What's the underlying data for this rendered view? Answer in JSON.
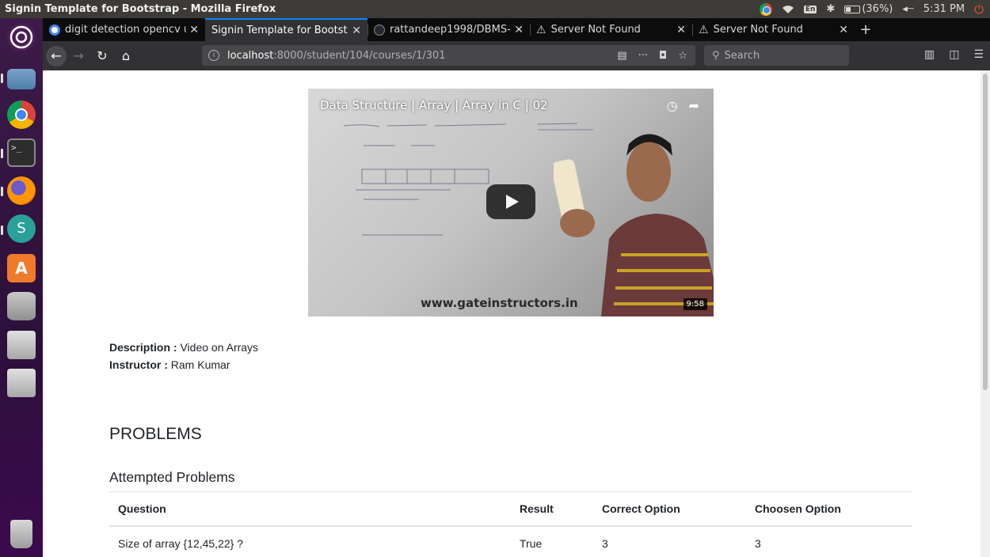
{
  "window": {
    "title": "Signin Template for Bootstrap - Mozilla Firefox"
  },
  "tray": {
    "lang": "En",
    "battery": "(36%)",
    "time": "5:31 PM"
  },
  "tabs": [
    {
      "label": "digit detection opencv u",
      "favicon_color": "#4285f4",
      "active": false
    },
    {
      "label": "Signin Template for Bootst",
      "favicon_color": "",
      "active": true
    },
    {
      "label": "rattandeep1998/DBMS-",
      "favicon_color": "#24292e",
      "active": false
    },
    {
      "label": "Server Not Found",
      "favicon_color": "",
      "active": false
    },
    {
      "label": "Server Not Found",
      "favicon_color": "",
      "active": false
    }
  ],
  "nav": {
    "url_host": "localhost",
    "url_path": ":8000/student/104/courses/1/301",
    "search_placeholder": "Search"
  },
  "video": {
    "title": "Data Structure | Array | Array in C | 02",
    "watermark": "www.gateinstructors.in",
    "duration": "9:58"
  },
  "course": {
    "description_label": "Description :",
    "description": "Video on Arrays",
    "instructor_label": "Instructor :",
    "instructor": "Ram Kumar"
  },
  "problems": {
    "heading": "PROBLEMS",
    "attempted_heading": "Attempted Problems",
    "columns": [
      "Question",
      "Result",
      "Correct Option",
      "Choosen Option"
    ],
    "rows": [
      [
        "Size of array {12,45,22} ?",
        "True",
        "3",
        "3"
      ]
    ]
  },
  "colors": {
    "accent": "#0a84ff",
    "ubuntu_orange": "#e95420"
  }
}
